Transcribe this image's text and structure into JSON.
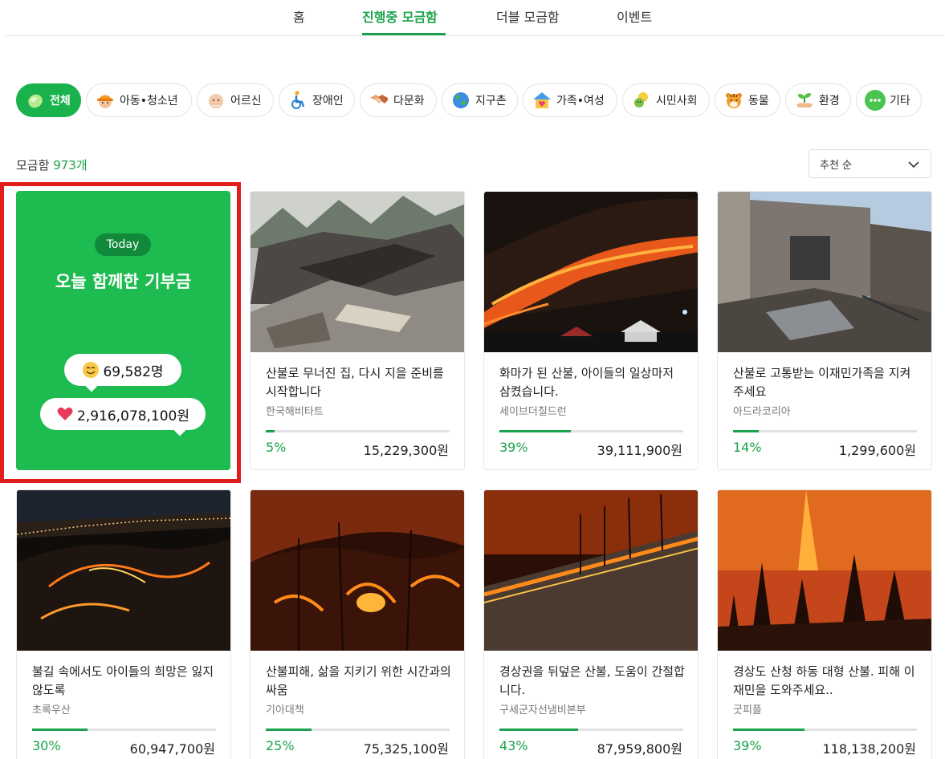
{
  "nav": {
    "tabs": [
      "홈",
      "진행중 모금함",
      "더블 모금함",
      "이벤트"
    ],
    "active_tab": "진행중 모금함"
  },
  "categories": [
    {
      "label": "전체",
      "icon": "all-leaf-icon",
      "active": true
    },
    {
      "label": "아동•청소년",
      "icon": "child-icon"
    },
    {
      "label": "어르신",
      "icon": "elder-icon"
    },
    {
      "label": "장애인",
      "icon": "wheelchair-icon"
    },
    {
      "label": "다문화",
      "icon": "handshake-icon"
    },
    {
      "label": "지구촌",
      "icon": "globe-icon"
    },
    {
      "label": "가족•여성",
      "icon": "family-house-icon"
    },
    {
      "label": "시민사회",
      "icon": "citizens-icon"
    },
    {
      "label": "동물",
      "icon": "tiger-icon"
    },
    {
      "label": "환경",
      "icon": "sprout-icon"
    },
    {
      "label": "기타",
      "icon": "more-dots-icon"
    }
  ],
  "summary": {
    "label": "모금함",
    "count": "973개"
  },
  "sort": {
    "selected": "추천 순"
  },
  "today": {
    "badge": "Today",
    "title": "오늘 함께한 기부금",
    "participants": "69,582명",
    "amount": "2,916,078,100원"
  },
  "cards": [
    {
      "title": "산불로 무너진 집, 다시 지을 준비를 시작합니다",
      "org": "한국해비타트",
      "percent": "5%",
      "progress": 0.05,
      "amount": "15,229,300원",
      "image": "burned-house-ruins"
    },
    {
      "title": "화마가 된 산불, 아이들의 일상마저 삼켰습니다.",
      "org": "세이브더칠드런",
      "percent": "39%",
      "progress": 0.39,
      "amount": "39,111,900원",
      "image": "hillside-wildfire-night"
    },
    {
      "title": "산불로 고통받는 이재민가족을 지켜주세요",
      "org": "아드라코리아",
      "percent": "14%",
      "progress": 0.14,
      "amount": "1,299,600원",
      "image": "burned-house-interior"
    },
    {
      "title": "불길 속에서도 아이들의 희망은 잃지 않도록",
      "org": "초록우산",
      "percent": "30%",
      "progress": 0.3,
      "amount": "60,947,700원",
      "image": "mountain-fire-lines-night"
    },
    {
      "title": "산불피해, 삶을 지키기 위한 시간과의 싸움",
      "org": "기아대책",
      "percent": "25%",
      "progress": 0.25,
      "amount": "75,325,100원",
      "image": "forest-fire-night"
    },
    {
      "title": "경상권을 뒤덮은 산불, 도움이 간절합니다.",
      "org": "구세군자선냄비본부",
      "percent": "43%",
      "progress": 0.43,
      "amount": "87,959,800원",
      "image": "slope-fire-night"
    },
    {
      "title": "경상도 산청 하동 대형 산불. 피해 이재민을 도와주세요..",
      "org": "굿피플",
      "percent": "39%",
      "progress": 0.39,
      "amount": "118,138,200원",
      "image": "burning-pine-forest"
    }
  ],
  "colors": {
    "brand_green": "#1aa34a",
    "today_bg": "#1dbb50",
    "highlight_red": "#e21d1d"
  }
}
